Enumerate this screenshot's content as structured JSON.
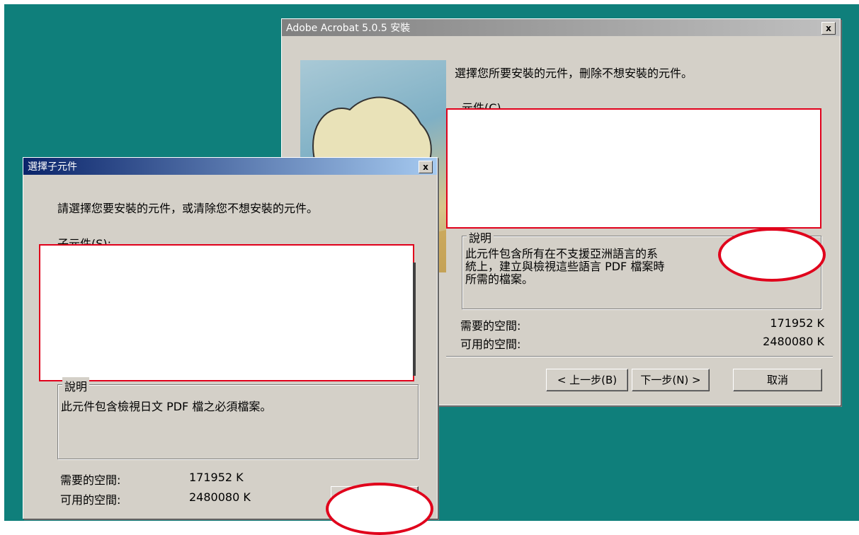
{
  "main_window": {
    "title": "Adobe Acrobat 5.0.5 安裝",
    "close_label": "x",
    "instruction": "選擇您所要安裝的元件，刪除不想安裝的元件。",
    "components_label": "元件(C)",
    "description_title": "說明",
    "description_lines": [
      "此元件包含所有在不支援亞洲語言的系",
      "統上，建立與檢視這些語言 PDF 檔案時",
      "所需的檔案。"
    ],
    "required_space_label": "需要的空間:",
    "required_space_value": "171952 K",
    "available_space_label": "可用的空間:",
    "available_space_value": "2480080 K",
    "back_button": "< 上一步(B)",
    "next_button": "下一步(N) >",
    "cancel_button": "取消"
  },
  "sub_dialog": {
    "title": "選擇子元件",
    "close_label": "x",
    "instruction": "請選擇您要安裝的元件，或清除您不想安裝的元件。",
    "subcomponents_label": "子元件(S):",
    "description_title": "說明",
    "description": "此元件包含檢視日文 PDF 檔之必須檔案。",
    "required_space_label": "需要的空間:",
    "required_space_value": "171952 K",
    "available_space_label": "可用的空間:",
    "available_space_value": "2480080 K"
  },
  "colors": {
    "desktop": "#0f7f7b",
    "annotation_red": "#e0001b",
    "title_active_start": "#0a246a",
    "title_active_end": "#a6caf0",
    "title_inactive": "#808080"
  }
}
